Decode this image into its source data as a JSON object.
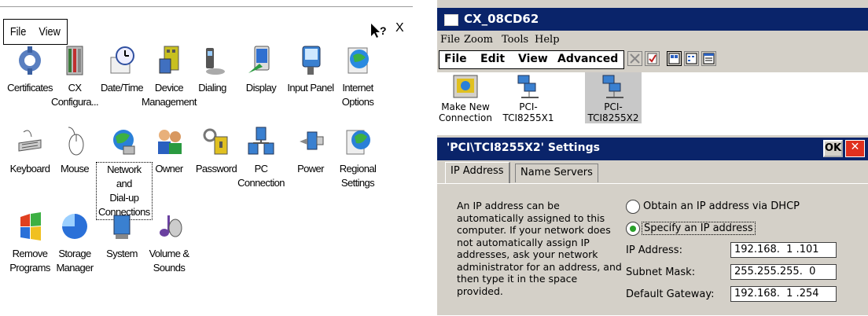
{
  "control_panel": {
    "menu": [
      "File",
      "View"
    ],
    "help_glyph": "?",
    "close_glyph": "X",
    "items": [
      {
        "label": "Certificates",
        "icon": "certificates-icon"
      },
      {
        "label": "CX\nConfigura...",
        "icon": "cx-configuration-icon"
      },
      {
        "label": "Date/Time",
        "icon": "datetime-icon"
      },
      {
        "label": "Device\nManagement",
        "icon": "device-management-icon"
      },
      {
        "label": "Dialing",
        "icon": "dialing-icon"
      },
      {
        "label": "Display",
        "icon": "display-icon"
      },
      {
        "label": "Input Panel",
        "icon": "input-panel-icon"
      },
      {
        "label": "Internet\nOptions",
        "icon": "internet-options-icon"
      },
      {
        "label": "Keyboard",
        "icon": "keyboard-icon"
      },
      {
        "label": "Mouse",
        "icon": "mouse-icon"
      },
      {
        "label": "Network and\nDial-up\nConnections",
        "icon": "network-icon",
        "selected": true
      },
      {
        "label": "Owner",
        "icon": "owner-icon"
      },
      {
        "label": "Password",
        "icon": "password-icon"
      },
      {
        "label": "PC\nConnection",
        "icon": "pc-connection-icon"
      },
      {
        "label": "Power",
        "icon": "power-icon"
      },
      {
        "label": "Regional\nSettings",
        "icon": "regional-settings-icon"
      },
      {
        "label": "Remove\nPrograms",
        "icon": "remove-programs-icon"
      },
      {
        "label": "Storage\nManager",
        "icon": "storage-manager-icon"
      },
      {
        "label": "System",
        "icon": "system-icon"
      },
      {
        "label": "Volume &\nSounds",
        "icon": "volume-icon"
      }
    ]
  },
  "network_window": {
    "title": "CX_08CD62",
    "menu": [
      "File",
      "Zoom",
      "Tools",
      "Help"
    ],
    "command_bar": [
      "File",
      "Edit",
      "View",
      "Advanced"
    ],
    "connections": [
      {
        "label": "Make New\nConnection"
      },
      {
        "label": "PCI-\nTCI8255X1"
      },
      {
        "label": "PCI-\nTCI8255X2",
        "selected": true
      }
    ]
  },
  "settings_dialog": {
    "title": "'PCI\\TCI8255X2' Settings",
    "ok": "OK",
    "close": "✕",
    "tabs": [
      "IP Address",
      "Name Servers"
    ],
    "description": "An IP address can be automatically assigned to this computer.  If your network does not automatically assign IP addresses, ask your network administrator for an address, and then type it in the space provided.",
    "dhcp_option": "Obtain an IP address via DHCP",
    "static_option": "Specify an IP address",
    "fields": [
      {
        "label": "IP Address:",
        "value": "192.168.  1 .101"
      },
      {
        "label": "Subnet Mask:",
        "value": "255.255.255.  0"
      },
      {
        "label": "Default Gateway:",
        "value": "192.168.  1 .254"
      }
    ],
    "accent_color": "#0a246a",
    "radio_selected_color": "#2aa02a"
  }
}
